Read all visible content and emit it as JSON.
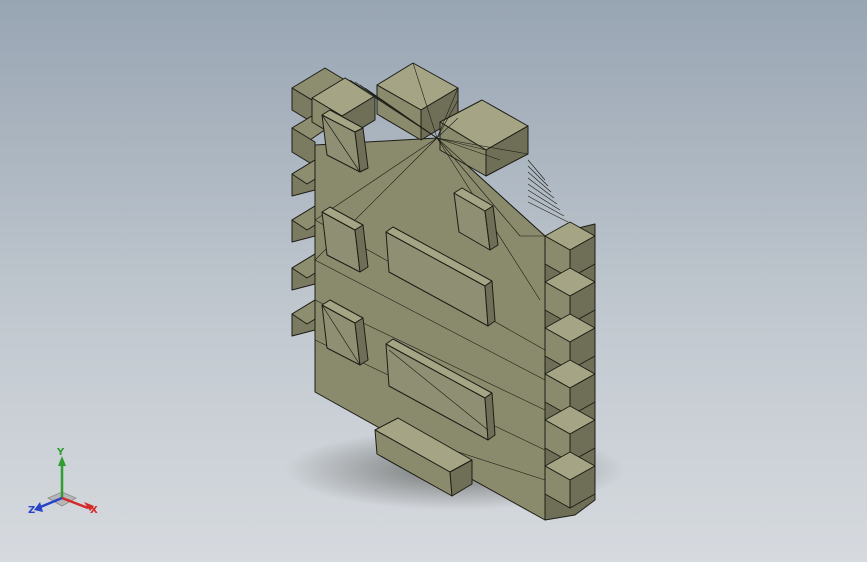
{
  "viewport": {
    "background_top": "#98a5b3",
    "background_bottom": "#d6dadf"
  },
  "model": {
    "face_color": "#8a8a6c",
    "face_light": "#a5a586",
    "face_dark": "#6f6f57",
    "edge_color": "#1d1d16"
  },
  "triad": {
    "labels": {
      "y": "Y",
      "x": "X",
      "z": "Z"
    },
    "colors": {
      "x": "#d42a2a",
      "y": "#2f9e2f",
      "z": "#2744c9"
    }
  }
}
